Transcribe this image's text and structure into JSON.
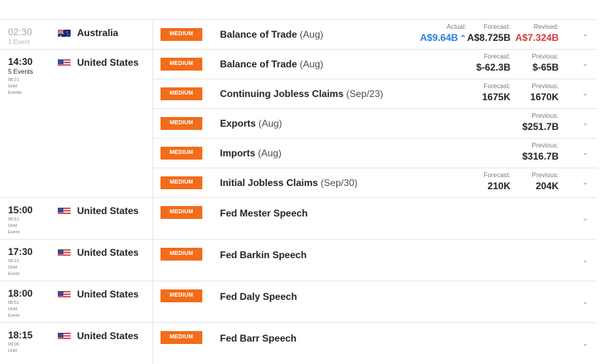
{
  "groups": [
    {
      "time": "02:30",
      "sub": "1 Event",
      "past": true,
      "until": [],
      "country": "Australia",
      "flag": "au",
      "events": [
        {
          "impact": "MEDIUM",
          "name": "Balance of Trade",
          "period": "(Aug)",
          "actual_label": "Actual:",
          "actual": "A$9.64B",
          "forecast_label": "Forecast:",
          "forecast": "A$8.725B",
          "prev_label": "Revised:",
          "prev": "A$7.324B"
        }
      ]
    },
    {
      "time": "14:30",
      "sub": "5 Events",
      "past": false,
      "until": [
        "08:21",
        "Until",
        "Events"
      ],
      "country": "United States",
      "flag": "us",
      "events": [
        {
          "impact": "MEDIUM",
          "name": "Balance of Trade",
          "period": "(Aug)",
          "forecast_label": "Forecast:",
          "forecast": "$-62.3B",
          "prev_label": "Previous:",
          "prev": "$-65B"
        },
        {
          "impact": "MEDIUM",
          "name": "Continuing Jobless Claims",
          "period": "(Sep/23)",
          "forecast_label": "Forecast:",
          "forecast": "1675K",
          "prev_label": "Previous:",
          "prev": "1670K"
        },
        {
          "impact": "MEDIUM",
          "name": "Exports",
          "period": "(Aug)",
          "prev_label": "Previous:",
          "prev": "$251.7B"
        },
        {
          "impact": "MEDIUM",
          "name": "Imports",
          "period": "(Aug)",
          "prev_label": "Previous:",
          "prev": "$316.7B"
        },
        {
          "impact": "MEDIUM",
          "name": "Initial Jobless Claims",
          "period": "(Sep/30)",
          "forecast_label": "Forecast:",
          "forecast": "210K",
          "prev_label": "Previous:",
          "prev": "204K"
        }
      ]
    },
    {
      "time": "15:00",
      "sub": "",
      "past": false,
      "until": [
        "08:51",
        "Until",
        "Event"
      ],
      "country": "United States",
      "flag": "us",
      "events": [
        {
          "impact": "MEDIUM",
          "name": "Fed Mester Speech",
          "period": ""
        }
      ]
    },
    {
      "time": "17:30",
      "sub": "",
      "past": false,
      "until": [
        "08:21",
        "Until",
        "Event"
      ],
      "country": "United States",
      "flag": "us",
      "events": [
        {
          "impact": "MEDIUM",
          "name": "Fed Barkin Speech",
          "period": ""
        }
      ]
    },
    {
      "time": "18:00",
      "sub": "",
      "past": false,
      "until": [
        "08:51",
        "Until",
        "Event"
      ],
      "country": "United States",
      "flag": "us",
      "events": [
        {
          "impact": "MEDIUM",
          "name": "Fed Daly Speech",
          "period": ""
        }
      ]
    },
    {
      "time": "18:15",
      "sub": "",
      "past": false,
      "until": [
        "09:06",
        "Until"
      ],
      "country": "United States",
      "flag": "us",
      "events": [
        {
          "impact": "MEDIUM",
          "name": "Fed Barr Speech",
          "period": ""
        }
      ]
    }
  ],
  "icons": {
    "expand": "chevron-down-icon",
    "actual_trend": "arrow-up-icon"
  },
  "colors": {
    "badge": "#f26c1a",
    "actual": "#2a7de1",
    "revised": "#d23a3a"
  }
}
